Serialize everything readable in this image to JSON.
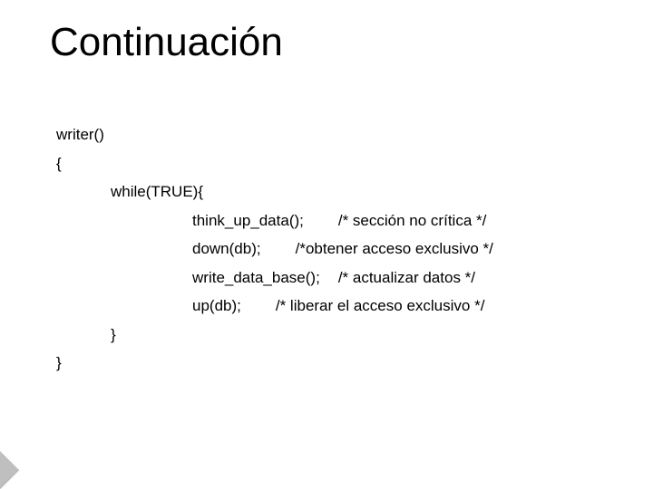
{
  "title": "Continuación",
  "lines": {
    "fn_decl": "writer()",
    "open": "{",
    "while": "while(TRUE){",
    "think": "think_up_data();",
    "think_c": "/* sección no crítica */",
    "down": "down(db);",
    "down_c": "/*obtener acceso exclusivo */",
    "write": "write_data_base();",
    "write_c": "/* actualizar datos */",
    "up": "up(db);",
    "up_c": "/* liberar el acceso exclusivo */",
    "inner_close": "}",
    "close": "}"
  }
}
